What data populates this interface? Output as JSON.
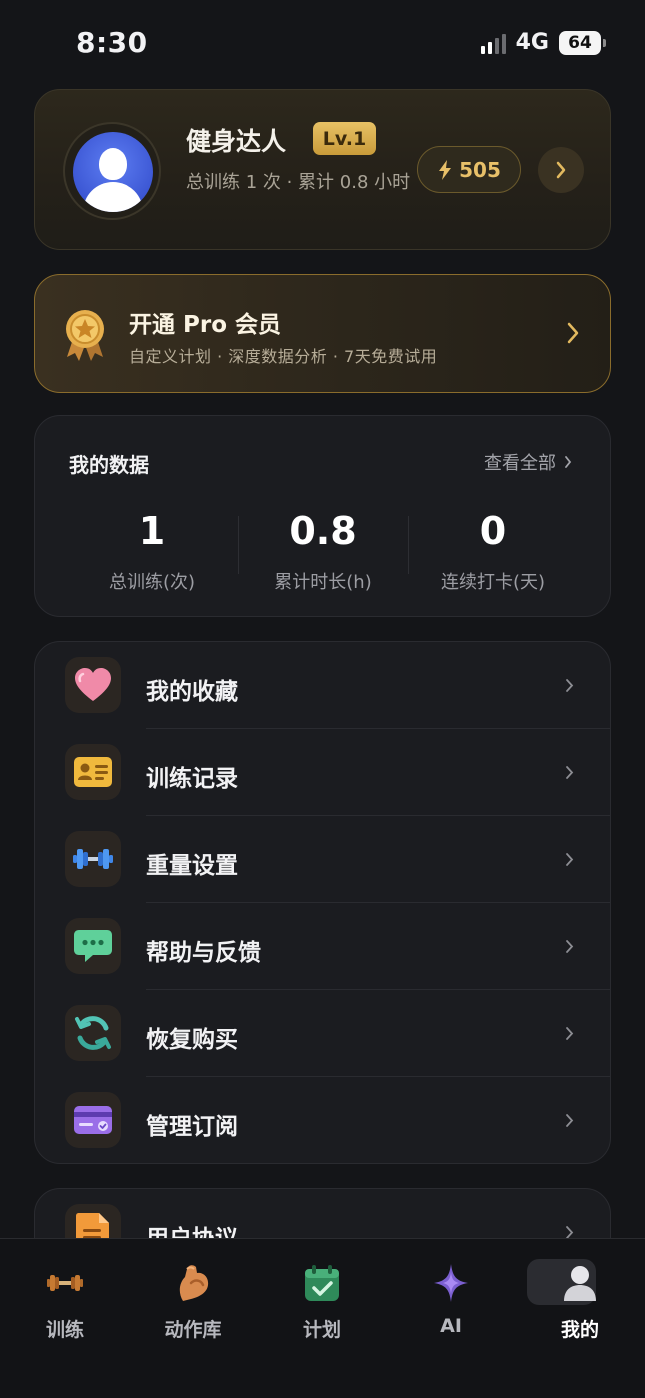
{
  "status_bar": {
    "time": "8:30",
    "network": "4G",
    "battery": "64"
  },
  "profile": {
    "name": "健身达人",
    "level": "Lv.1",
    "stats": "总训练 1 次 · 累计 0.8 小时",
    "energy": "505"
  },
  "pro": {
    "title": "开通 Pro 会员",
    "subtitle": "自定义计划 · 深度数据分析 · 7天免费试用"
  },
  "data_section": {
    "title": "我的数据",
    "view_all": "查看全部",
    "stats": [
      {
        "value": "1",
        "label": "总训练(次)"
      },
      {
        "value": "0.8",
        "label": "累计时长(h)"
      },
      {
        "value": "0",
        "label": "连续打卡(天)"
      }
    ]
  },
  "menu": {
    "items": [
      {
        "label": "我的收藏",
        "icon": "heart-icon"
      },
      {
        "label": "训练记录",
        "icon": "id-card-icon"
      },
      {
        "label": "重量设置",
        "icon": "dumbbell-icon"
      },
      {
        "label": "帮助与反馈",
        "icon": "chat-bubble-icon"
      },
      {
        "label": "恢复购买",
        "icon": "refresh-icon"
      },
      {
        "label": "管理订阅",
        "icon": "credit-card-icon"
      }
    ],
    "items_2": [
      {
        "label": "用户协议",
        "icon": "document-icon"
      }
    ]
  },
  "tabbar": {
    "tabs": [
      {
        "label": "训练",
        "icon": "dumbbell-icon"
      },
      {
        "label": "动作库",
        "icon": "biceps-icon"
      },
      {
        "label": "计划",
        "icon": "calendar-check-icon"
      },
      {
        "label": "AI",
        "icon": "sparkle-icon"
      },
      {
        "label": "我的",
        "icon": "user-icon"
      }
    ],
    "active": "我的"
  },
  "colors": {
    "gold": "#e8c069",
    "background": "#141518",
    "card": "#1b1c20"
  }
}
